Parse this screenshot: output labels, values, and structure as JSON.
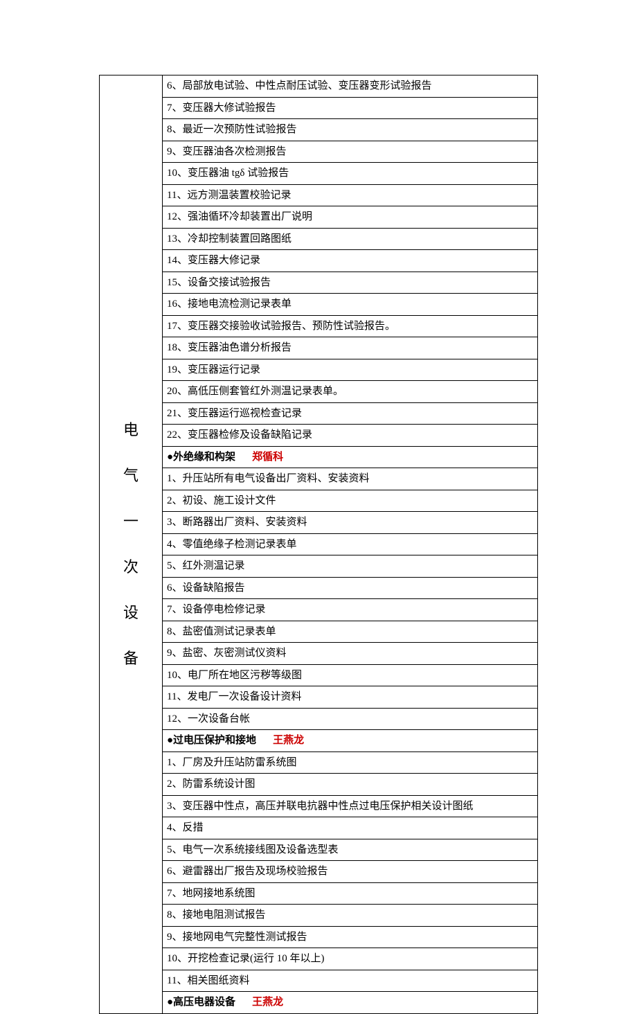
{
  "category_label": "电\n气\n一\n次\n设\n备",
  "sections": [
    {
      "header": null,
      "items": [
        "6、局部放电试验、中性点耐压试验、变压器变形试验报告",
        "7、变压器大修试验报告",
        "8、最近一次预防性试验报告",
        "9、变压器油各次检测报告",
        "10、变压器油 tgδ 试验报告",
        "11、远方测温装置校验记录",
        "12、强油循环冷却装置出厂说明",
        "13、冷却控制装置回路图纸",
        "14、变压器大修记录",
        "15、设备交接试验报告",
        "16、接地电流检测记录表单",
        "17、变压器交接验收试验报告、预防性试验报告。",
        "18、变压器油色谱分析报告",
        "19、变压器运行记录",
        "20、高低压侧套管红外测温记录表单。",
        "21、变压器运行巡视检查记录",
        "22、变压器检修及设备缺陷记录"
      ]
    },
    {
      "header": {
        "title": "●外绝缘和构架",
        "person": "郑循科"
      },
      "items": [
        "1、升压站所有电气设备出厂资料、安装资料",
        "2、初设、施工设计文件",
        "3、断路器出厂资料、安装资料",
        "4、零值绝缘子检测记录表单",
        "5、红外测温记录",
        "6、设备缺陷报告",
        "7、设备停电检修记录",
        "8、盐密值测试记录表单",
        "9、盐密、灰密测试仪资料",
        "10、电厂所在地区污秽等级图",
        "11、发电厂一次设备设计资料",
        "12、一次设备台帐"
      ]
    },
    {
      "header": {
        "title": "●过电压保护和接地",
        "person": "王燕龙"
      },
      "items": [
        "1、厂房及升压站防雷系统图",
        "2、防雷系统设计图",
        "3、变压器中性点，高压并联电抗器中性点过电压保护相关设计图纸",
        "4、反措",
        "5、电气一次系统接线图及设备选型表",
        "6、避雷器出厂报告及现场校验报告",
        "7、地网接地系统图",
        "8、接地电阻测试报告",
        "9、接地网电气完整性测试报告",
        "10、开挖检查记录(运行 10 年以上)",
        "11、相关图纸资料"
      ]
    },
    {
      "header": {
        "title": "●高压电器设备",
        "person": "王燕龙"
      },
      "items": []
    }
  ]
}
